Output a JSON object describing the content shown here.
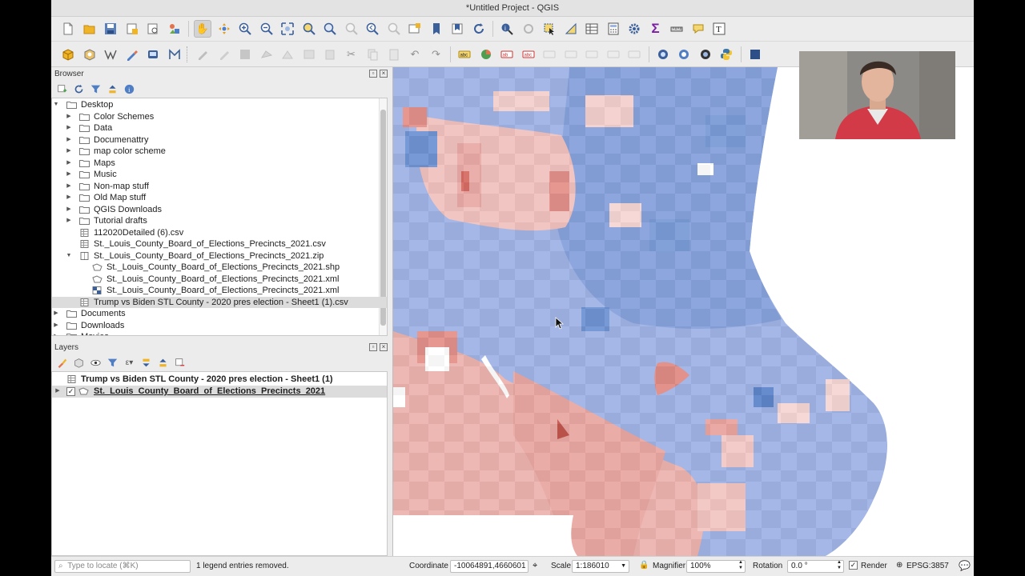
{
  "window": {
    "title": "*Untitled Project - QGIS"
  },
  "browser": {
    "title": "Browser",
    "items": [
      {
        "label": "Desktop",
        "type": "folder",
        "level": 1,
        "expanded": true
      },
      {
        "label": "Color Schemes",
        "type": "folder",
        "level": 2,
        "expanded": false
      },
      {
        "label": "Data",
        "type": "folder",
        "level": 2,
        "expanded": false
      },
      {
        "label": "Documenattry",
        "type": "folder",
        "level": 2,
        "expanded": false
      },
      {
        "label": "map color scheme",
        "type": "folder",
        "level": 2,
        "expanded": false
      },
      {
        "label": "Maps",
        "type": "folder",
        "level": 2,
        "expanded": false
      },
      {
        "label": "Music",
        "type": "folder",
        "level": 2,
        "expanded": false
      },
      {
        "label": "Non-map stuff",
        "type": "folder",
        "level": 2,
        "expanded": false
      },
      {
        "label": "Old Map stuff",
        "type": "folder",
        "level": 2,
        "expanded": false
      },
      {
        "label": "QGIS Downloads",
        "type": "folder",
        "level": 2,
        "expanded": false
      },
      {
        "label": "Tutorial drafts",
        "type": "folder",
        "level": 2,
        "expanded": false
      },
      {
        "label": "112020Detailed (6).csv",
        "type": "table",
        "level": 2
      },
      {
        "label": "St._Louis_County_Board_of_Elections_Precincts_2021.csv",
        "type": "table",
        "level": 2
      },
      {
        "label": "St._Louis_County_Board_of_Elections_Precincts_2021.zip",
        "type": "zip",
        "level": 2,
        "expanded": true
      },
      {
        "label": "St._Louis_County_Board_of_Elections_Precincts_2021.shp",
        "type": "polygon",
        "level": 3
      },
      {
        "label": "St._Louis_County_Board_of_Elections_Precincts_2021.xml",
        "type": "polygon",
        "level": 3
      },
      {
        "label": "St._Louis_County_Board_of_Elections_Precincts_2021.xml",
        "type": "raster",
        "level": 3
      },
      {
        "label": "Trump vs Biden STL County - 2020 pres election - Sheet1 (1).csv",
        "type": "table",
        "level": 2,
        "selected": true
      },
      {
        "label": "Documents",
        "type": "folder",
        "level": 1,
        "expanded": false
      },
      {
        "label": "Downloads",
        "type": "folder",
        "level": 1,
        "expanded": false
      },
      {
        "label": "Movies",
        "type": "folder",
        "level": 1,
        "expanded": false
      }
    ]
  },
  "layers": {
    "title": "Layers",
    "items": [
      {
        "label": "Trump vs Biden STL County - 2020 pres election - Sheet1 (1)",
        "type": "table",
        "checked": null
      },
      {
        "label": "St._Louis_County_Board_of_Elections_Precincts_2021",
        "type": "polygon",
        "checked": true,
        "selected": true
      }
    ]
  },
  "status": {
    "locate_placeholder": "Type to locate (⌘K)",
    "message": "1 legend entries removed.",
    "coordinate_label": "Coordinate",
    "coordinate_value": "-10064891,4660601",
    "scale_label": "Scale",
    "scale_value": "1:186010",
    "magnifier_label": "Magnifier",
    "magnifier_value": "100%",
    "rotation_label": "Rotation",
    "rotation_value": "0.0 °",
    "render_label": "Render",
    "render_checked": true,
    "crs": "EPSG:3857"
  },
  "colors": {
    "accent_select": "#dcdcdc",
    "map_blue": "#8fa8df",
    "map_red": "#e8a5a0",
    "map_white": "#ffffff"
  }
}
